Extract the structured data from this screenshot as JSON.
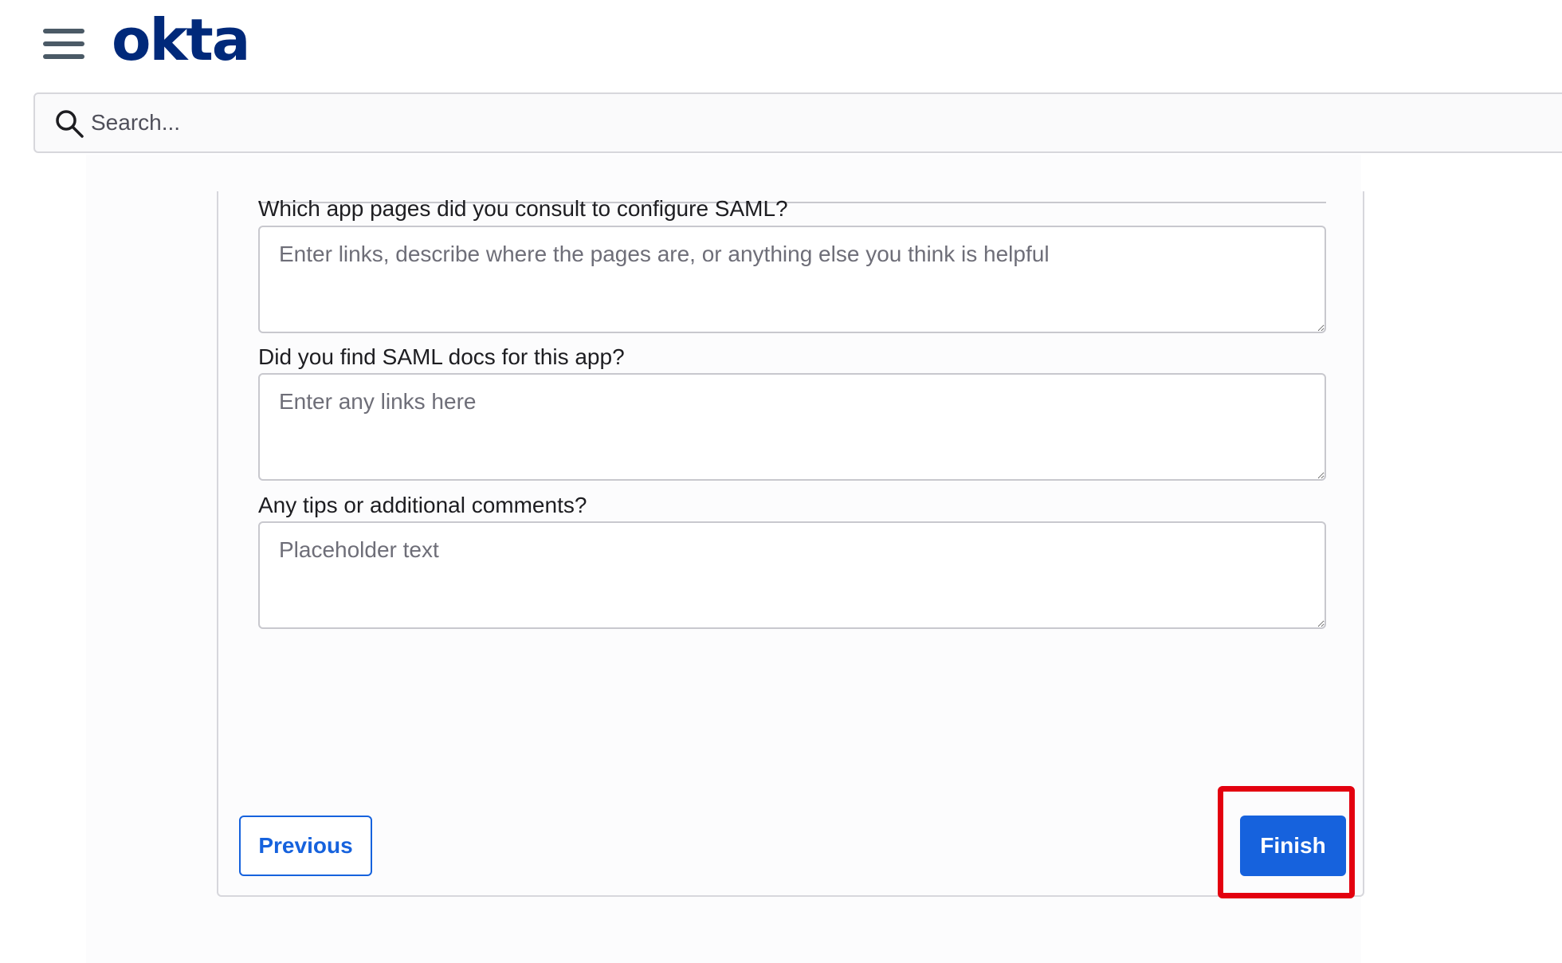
{
  "header": {
    "logo_text": "okta",
    "brand_color": "#00297a"
  },
  "search": {
    "placeholder": "Search...",
    "icon": "search-icon"
  },
  "form": {
    "fields": [
      {
        "label": "Which app pages did you consult to configure SAML?",
        "placeholder": "Enter links, describe where the pages are, or anything else you think is helpful"
      },
      {
        "label": "Did you find SAML docs for this app?",
        "placeholder": "Enter any links here"
      },
      {
        "label": "Any tips or additional comments?",
        "placeholder": "Placeholder text"
      }
    ],
    "previous_label": "Previous",
    "finish_label": "Finish"
  },
  "colors": {
    "primary": "#1662dd",
    "highlight": "#e3000f"
  }
}
